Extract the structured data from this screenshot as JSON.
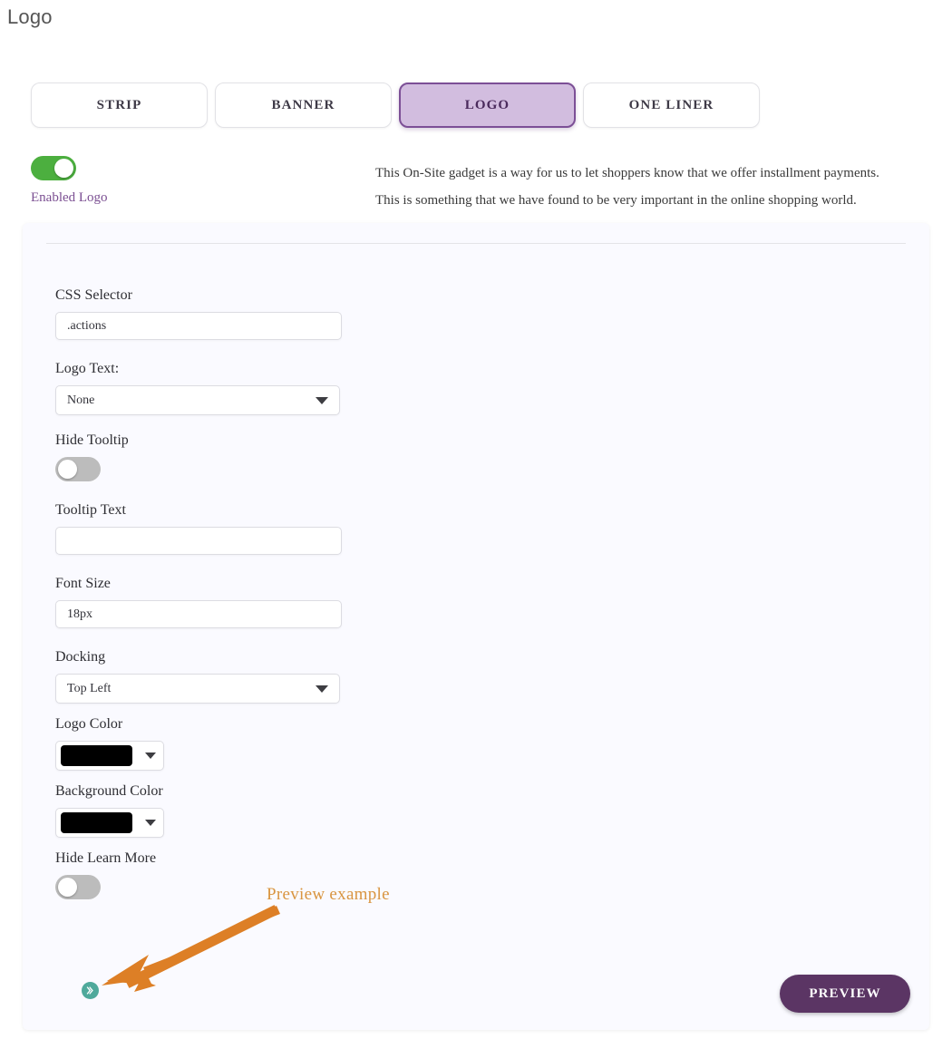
{
  "page": {
    "title": "Logo"
  },
  "tabs": [
    {
      "label": "STRIP",
      "active": false,
      "name": "tab-strip"
    },
    {
      "label": "BANNER",
      "active": false,
      "name": "tab-banner"
    },
    {
      "label": "LOGO",
      "active": true,
      "name": "tab-logo"
    },
    {
      "label": "ONE LINER",
      "active": false,
      "name": "tab-one-liner"
    }
  ],
  "enable": {
    "label": "Enabled Logo",
    "state": "on",
    "color_on": "#4caf3f"
  },
  "description": {
    "line1": "This On-Site gadget is a way for us to let shoppers know that we offer installment payments.",
    "line2": "This is something that we have found to be very important in the online shopping world."
  },
  "form": {
    "css_selector": {
      "label": "CSS Selector",
      "value": ".actions",
      "placeholder": ""
    },
    "logo_text": {
      "label": "Logo Text:",
      "value": "None",
      "options": [
        "None"
      ]
    },
    "hide_tooltip": {
      "label": "Hide Tooltip",
      "state": "off"
    },
    "tooltip_text": {
      "label": "Tooltip Text",
      "value": "",
      "placeholder": ""
    },
    "font_size": {
      "label": "Font Size",
      "value": "18px",
      "placeholder": ""
    },
    "docking": {
      "label": "Docking",
      "value": "Top Left",
      "options": [
        "Top Left"
      ]
    },
    "logo_color": {
      "label": "Logo Color",
      "value": "#000000"
    },
    "background_color": {
      "label": "Background Color",
      "value": "#000000"
    },
    "hide_learn_more": {
      "label": "Hide Learn More",
      "state": "off"
    }
  },
  "annotation": {
    "text": "Preview example",
    "color": "#d99540"
  },
  "preview_badge": {
    "color": "#4fa99b"
  },
  "actions": {
    "preview_label": "PREVIEW",
    "preview_color": "#5b3564"
  }
}
